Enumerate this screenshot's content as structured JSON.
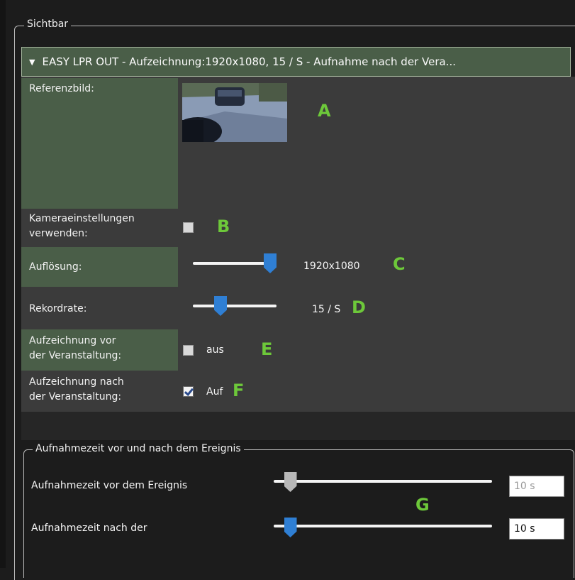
{
  "group_visible": {
    "legend": "Sichtbar"
  },
  "camera": {
    "header": "EASY LPR OUT - Aufzeichnung:1920x1080, 15 / S - Aufnahme nach der Vera..."
  },
  "settings": {
    "reference_image_label": "Referenzbild:",
    "use_camera_settings_label_1": "Kameraeinstellungen",
    "use_camera_settings_label_2": "verwenden:",
    "use_camera_settings_checked": false,
    "resolution_label": "Auflösung:",
    "resolution_value": "1920x1080",
    "resolution_slider_fraction": 1.0,
    "record_rate_label": "Rekordrate:",
    "record_rate_value": "15 / S",
    "record_rate_slider_fraction": 0.3,
    "pre_event_label_1": "Aufzeichnung vor",
    "pre_event_label_2": "der Veranstaltung:",
    "pre_event_checked": false,
    "pre_event_state": "aus",
    "post_event_label_1": "Aufzeichnung nach",
    "post_event_label_2": "der Veranstaltung:",
    "post_event_checked": true,
    "post_event_state": "Auf"
  },
  "record_time_group": {
    "legend": "Aufnahmezeit vor und nach dem Ereignis",
    "pre_label": "Aufnahmezeit vor dem Ereignis",
    "pre_value": "10 s",
    "pre_slider_fraction": 0.05,
    "post_label": "Aufnahmezeit nach der",
    "post_value": "10 s",
    "post_slider_fraction": 0.05
  },
  "markers": [
    "A",
    "B",
    "C",
    "D",
    "E",
    "F",
    "G"
  ],
  "colors": {
    "label_bg": "#4a5e48",
    "marker": "#6dc83a",
    "slider_thumb": "#2f7fd4"
  }
}
